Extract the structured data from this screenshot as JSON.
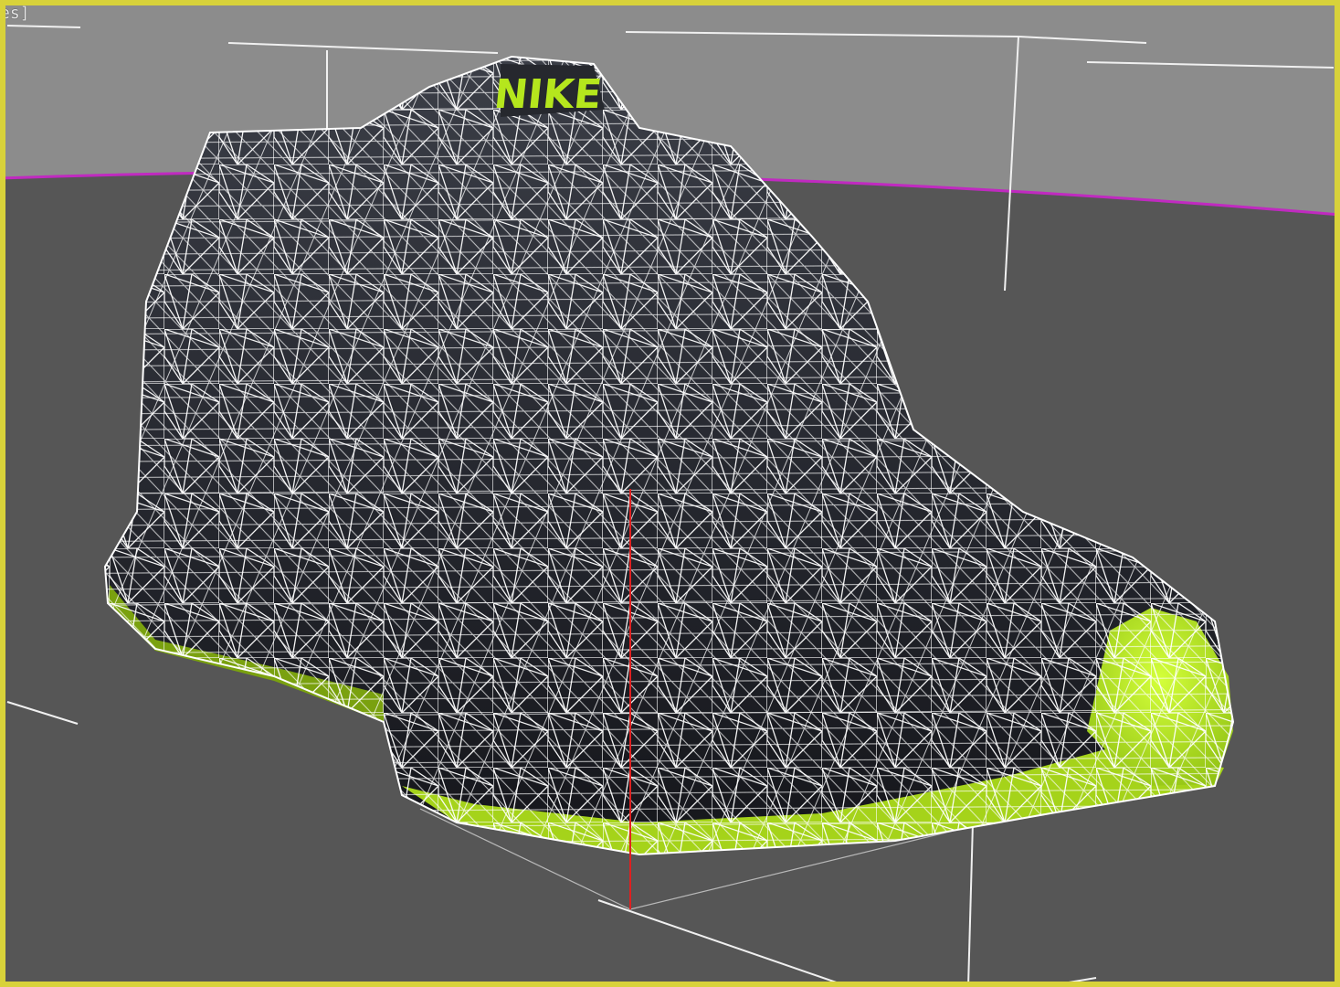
{
  "viewport": {
    "label": "es]",
    "active_border_color": "#d8d23a",
    "background_upper": "#8a8a8a",
    "background_lower": "#555555",
    "horizon_color": "#c02ac0"
  },
  "model": {
    "logo_text": "NIKE",
    "upper_color": "#2a2d36",
    "accent_color": "#b5e61d",
    "wireframe_color": "#ffffff",
    "pivot_axis_color": "#e02020"
  }
}
